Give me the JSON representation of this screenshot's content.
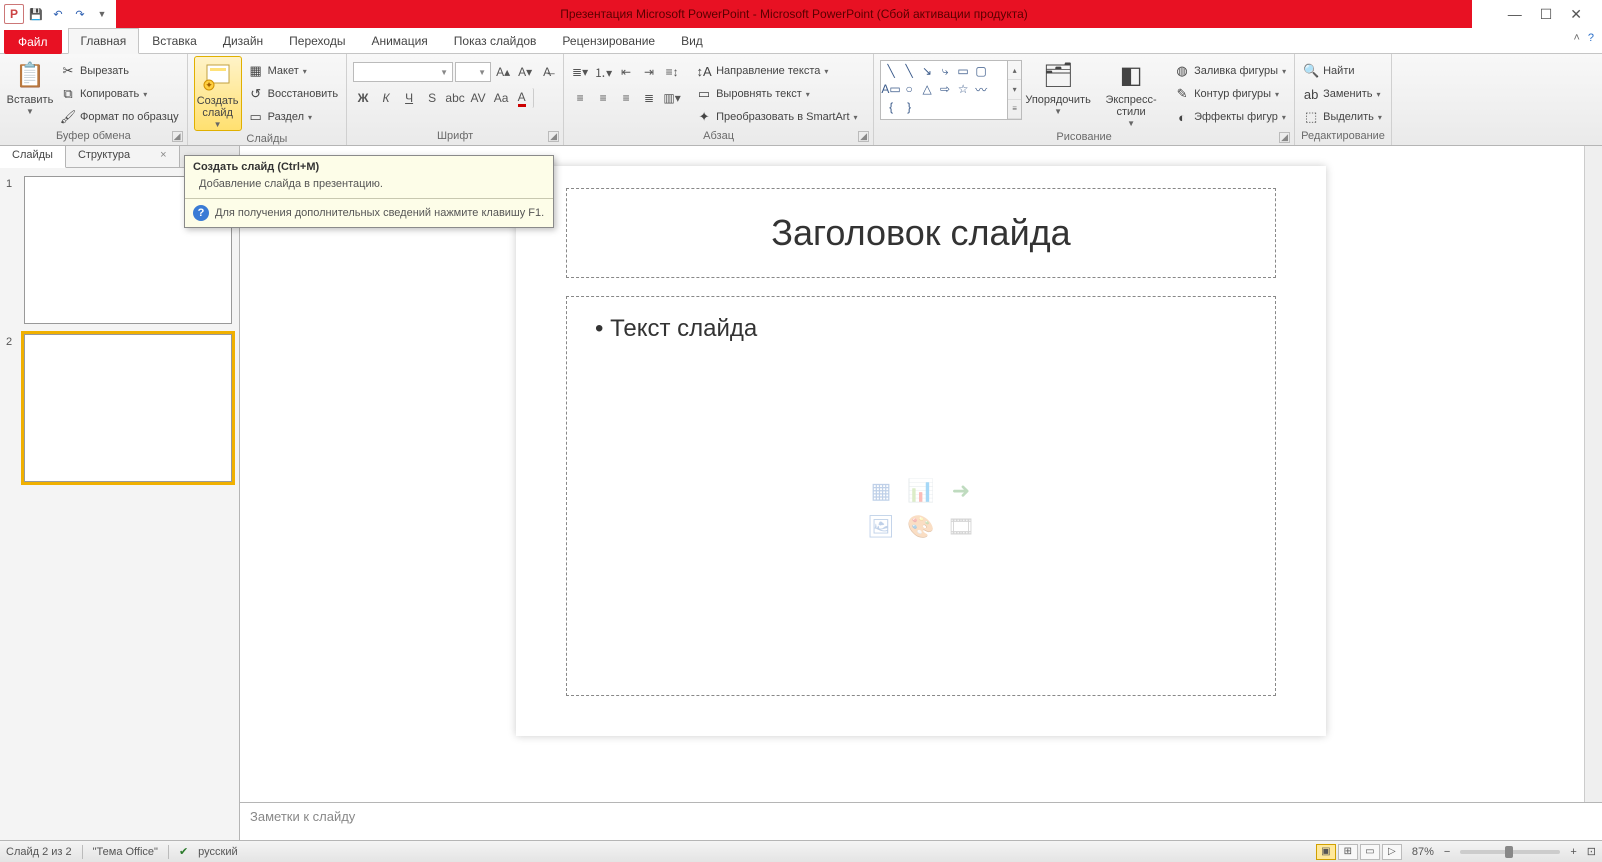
{
  "title": "Презентация Microsoft PowerPoint  -  Microsoft PowerPoint (Сбой активации продукта)",
  "tabs": {
    "file": "Файл",
    "home": "Главная",
    "insert": "Вставка",
    "design": "Дизайн",
    "transitions": "Переходы",
    "animations": "Анимация",
    "slideshow": "Показ слайдов",
    "review": "Рецензирование",
    "view": "Вид"
  },
  "clipboard": {
    "paste": "Вставить",
    "cut": "Вырезать",
    "copy": "Копировать",
    "format_painter": "Формат по образцу",
    "group": "Буфер обмена"
  },
  "slides_group": {
    "new_slide": "Создать слайд",
    "layout": "Макет",
    "reset": "Восстановить",
    "section": "Раздел",
    "group": "Слайды"
  },
  "font": {
    "group": "Шрифт"
  },
  "paragraph": {
    "text_direction": "Направление текста",
    "align_text": "Выровнять текст",
    "convert_smartart": "Преобразовать в SmartArt",
    "group": "Абзац"
  },
  "drawing": {
    "arrange": "Упорядочить",
    "quick_styles": "Экспресс-стили",
    "shape_fill": "Заливка фигуры",
    "shape_outline": "Контур фигуры",
    "shape_effects": "Эффекты фигур",
    "group": "Рисование"
  },
  "editing": {
    "find": "Найти",
    "replace": "Заменить",
    "select": "Выделить",
    "group": "Редактирование"
  },
  "side": {
    "slides_tab": "Слайды",
    "outline_tab": "Структура",
    "n1": "1",
    "n2": "2"
  },
  "slide": {
    "title": "Заголовок слайда",
    "body": "Текст слайда"
  },
  "notes_placeholder": "Заметки к слайду",
  "tooltip": {
    "title": "Создать слайд (Ctrl+M)",
    "body": "Добавление слайда в презентацию.",
    "help": "Для получения дополнительных сведений нажмите клавишу F1."
  },
  "status": {
    "slide_of": "Слайд 2 из 2",
    "theme": "\"Тема Office\"",
    "language": "русский",
    "zoom": "87%"
  }
}
